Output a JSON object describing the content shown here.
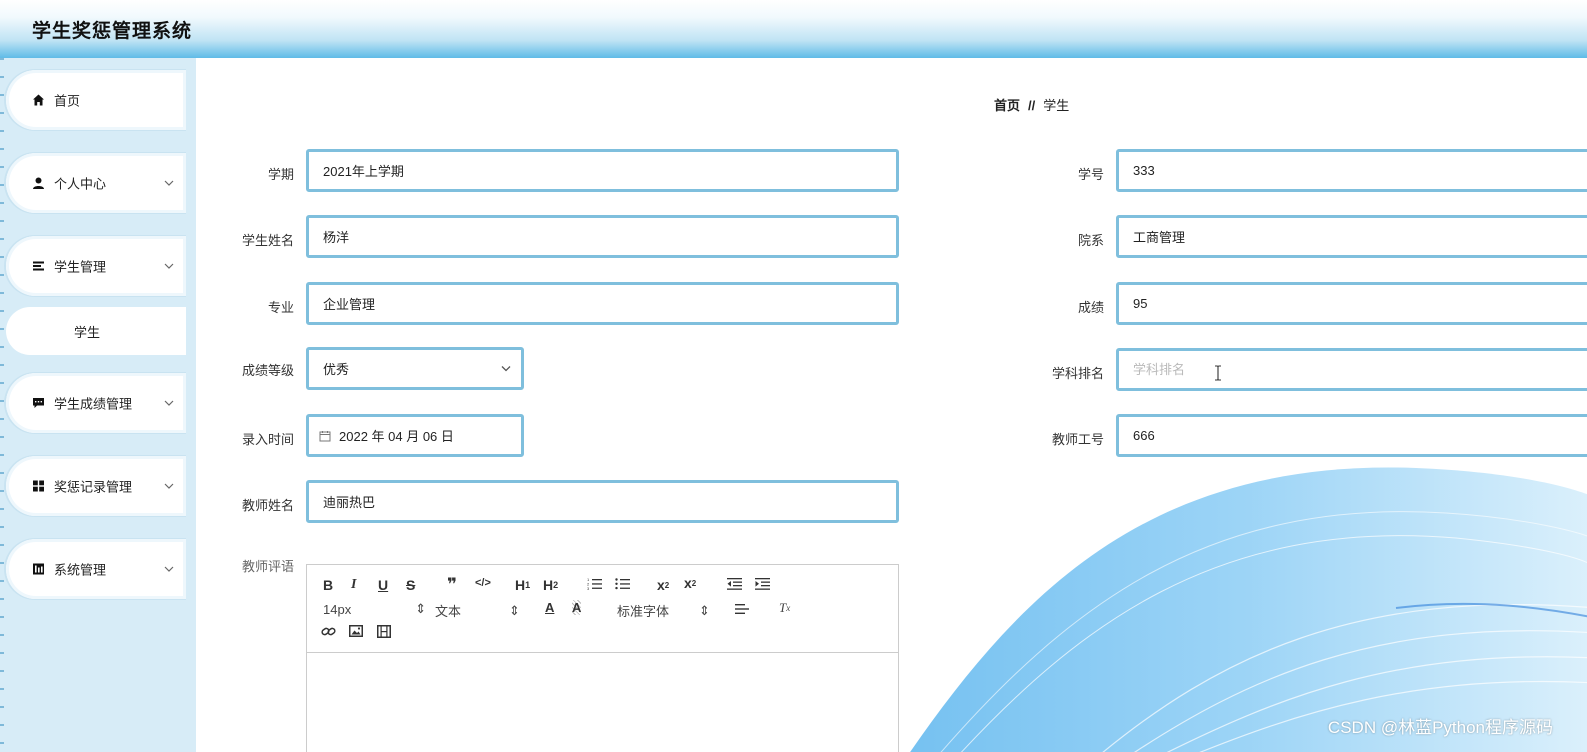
{
  "app": {
    "title": "学生奖惩管理系统"
  },
  "sidebar": {
    "items": [
      {
        "label": "首页",
        "icon": "home-icon"
      },
      {
        "label": "个人中心",
        "icon": "user-icon"
      },
      {
        "label": "学生管理",
        "icon": "list-icon"
      },
      {
        "label": "学生成绩管理",
        "icon": "chat-icon"
      },
      {
        "label": "奖惩记录管理",
        "icon": "grid-icon"
      },
      {
        "label": "系统管理",
        "icon": "chart-icon"
      }
    ],
    "sub_item": {
      "label": "学生"
    }
  },
  "breadcrumb": {
    "home": "首页",
    "separator": "//",
    "current": "学生"
  },
  "form": {
    "term": {
      "label": "学期",
      "value": "2021年上学期"
    },
    "student_no": {
      "label": "学号",
      "value": "333"
    },
    "student_name": {
      "label": "学生姓名",
      "value": "杨洋"
    },
    "department": {
      "label": "院系",
      "value": "工商管理"
    },
    "major": {
      "label": "专业",
      "value": "企业管理"
    },
    "score": {
      "label": "成绩",
      "value": "95"
    },
    "grade_level": {
      "label": "成绩等级",
      "value": "优秀"
    },
    "subject_rank": {
      "label": "学科排名",
      "placeholder": "学科排名"
    },
    "entry_time": {
      "label": "录入时间",
      "value": "2022 年 04 月 06 日"
    },
    "teacher_no": {
      "label": "教师工号",
      "value": "666"
    },
    "teacher_name": {
      "label": "教师姓名",
      "value": "迪丽热巴"
    },
    "teacher_comment": {
      "label": "教师评语"
    }
  },
  "editor": {
    "font_size": "14px",
    "format": "文本",
    "font_family": "标准字体"
  },
  "watermark": "CSDN @林蓝Python程序源码"
}
